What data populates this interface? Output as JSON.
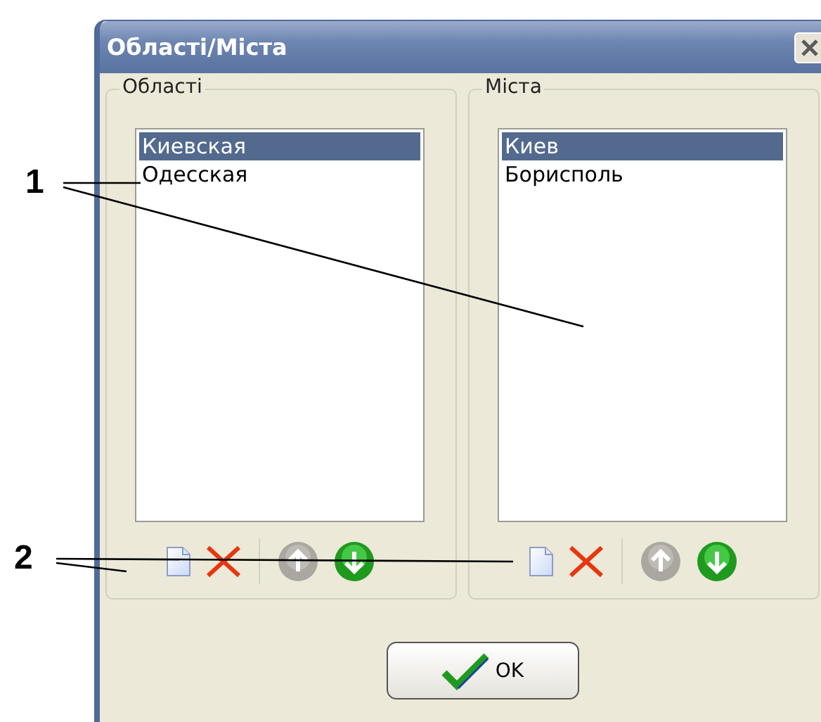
{
  "window": {
    "title": "Області/Міста"
  },
  "groups": [
    {
      "title": "Області",
      "items": [
        {
          "label": "Киевская",
          "selected": true
        },
        {
          "label": "Одесская",
          "selected": false
        }
      ],
      "toolbar": [
        {
          "kind": "new",
          "disabled": false
        },
        {
          "kind": "delete",
          "disabled": false
        },
        {
          "kind": "separator"
        },
        {
          "kind": "up",
          "disabled": true
        },
        {
          "kind": "down",
          "disabled": false
        }
      ]
    },
    {
      "title": "Міста",
      "items": [
        {
          "label": "Киев",
          "selected": true
        },
        {
          "label": "Борисполь",
          "selected": false
        }
      ],
      "toolbar": [
        {
          "kind": "new",
          "disabled": false
        },
        {
          "kind": "delete",
          "disabled": false
        },
        {
          "kind": "separator"
        },
        {
          "kind": "up",
          "disabled": true
        },
        {
          "kind": "down",
          "disabled": false
        }
      ]
    }
  ],
  "ok_button": {
    "label": "OK"
  },
  "callouts": [
    {
      "label": "1"
    },
    {
      "label": "2"
    }
  ]
}
